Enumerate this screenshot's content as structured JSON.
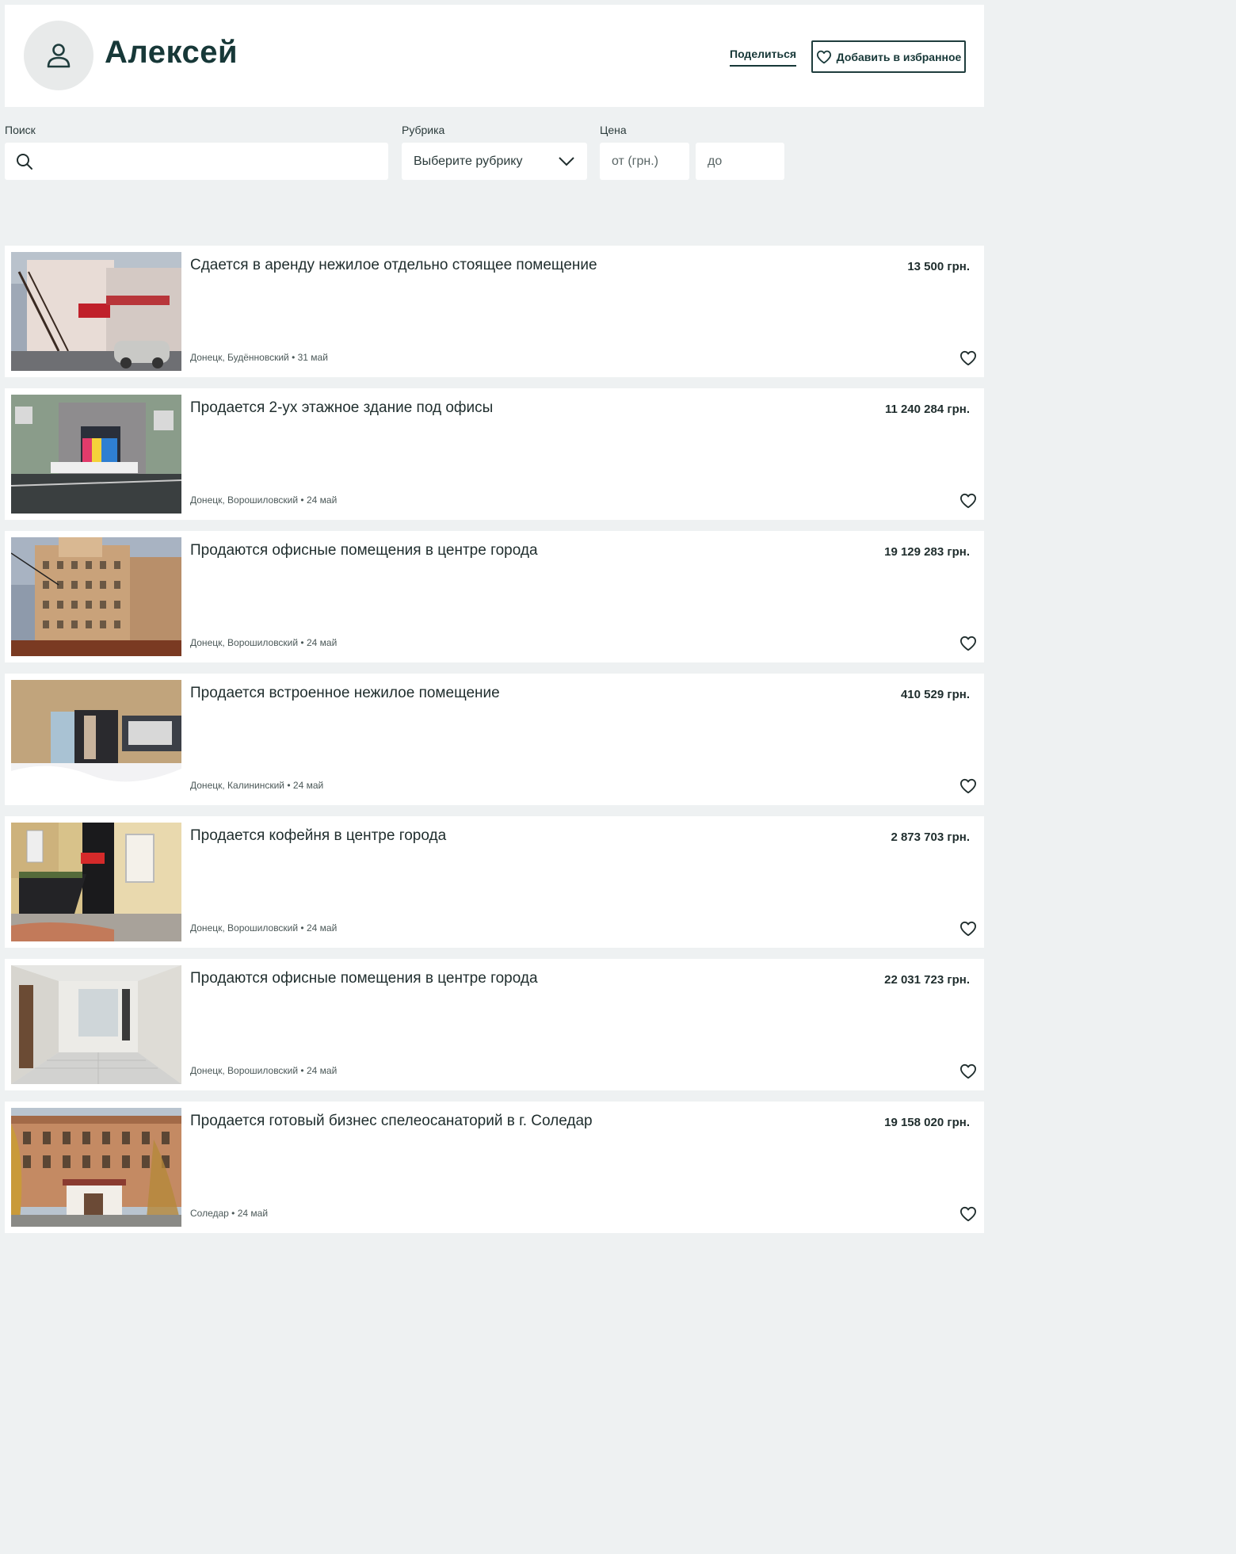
{
  "header": {
    "user_name": "Алексей",
    "share_label": "Поделиться",
    "favorite_label": "Добавить в избранное"
  },
  "filters": {
    "search_label": "Поиск",
    "rubric_label": "Рубрика",
    "rubric_value": "Выберите рубрику",
    "price_label": "Цена",
    "price_from_placeholder": "от (грн.)",
    "price_to_placeholder": "до"
  },
  "listings": [
    {
      "title": "Сдается в аренду нежилое отдельно стоящее помещение",
      "price": "13 500 грн.",
      "location": "Донецк, Будённовский",
      "date": "31 май",
      "image": "building-exterior-with-stairs"
    },
    {
      "title": "Продается 2-ух этажное здание под офисы",
      "price": "11 240 284 грн.",
      "location": "Донецк, Ворошиловский",
      "date": "24 май",
      "image": "office-building-entrance"
    },
    {
      "title": "Продаются офисные помещения в центре города",
      "price": "19 129 283 грн.",
      "location": "Донецк, Ворошиловский",
      "date": "24 май",
      "image": "high-rise-building"
    },
    {
      "title": "Продается встроенное нежилое помещение",
      "price": "410 529 грн.",
      "location": "Донецк, Калининский",
      "date": "24 май",
      "image": "shop-front-in-snow"
    },
    {
      "title": "Продается кофейня в центре города",
      "price": "2 873 703 грн.",
      "location": "Донецк, Ворошиловский",
      "date": "24 май",
      "image": "coffee-shop-entrance"
    },
    {
      "title": "Продаются офисные помещения в центре города",
      "price": "22 031 723 грн.",
      "location": "Донецк, Ворошиловский",
      "date": "24 май",
      "image": "office-corridor"
    },
    {
      "title": "Продается готовый бизнес спелеосанаторий в г. Соледар",
      "price": "19 158 020 грн.",
      "location": "Соледар",
      "date": "24 май",
      "image": "sanatorium-building"
    }
  ],
  "colors": {
    "page_background": "#eef1f2",
    "card_background": "#ffffff",
    "accent_dark": "#173838"
  }
}
